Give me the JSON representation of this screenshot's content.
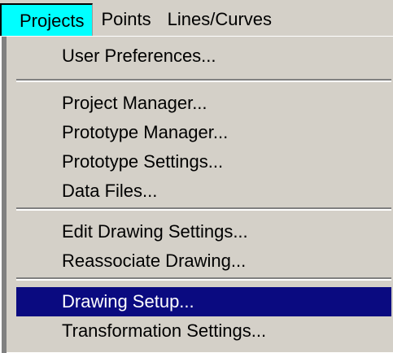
{
  "menubar": {
    "items": [
      {
        "label": "Projects"
      },
      {
        "label": "Points"
      },
      {
        "label": "Lines/Curves"
      }
    ]
  },
  "menu": {
    "items": [
      {
        "label": "User Preferences..."
      },
      {
        "label": "Project Manager..."
      },
      {
        "label": "Prototype Manager..."
      },
      {
        "label": "Prototype Settings..."
      },
      {
        "label": "Data Files..."
      },
      {
        "label": "Edit Drawing Settings..."
      },
      {
        "label": "Reassociate Drawing..."
      },
      {
        "label": "Drawing Setup..."
      },
      {
        "label": "Transformation Settings..."
      }
    ]
  },
  "colors": {
    "active_menu_bg": "#00ffff",
    "highlight_bg": "#0a0a80",
    "menu_bg": "#d4d0c8"
  }
}
